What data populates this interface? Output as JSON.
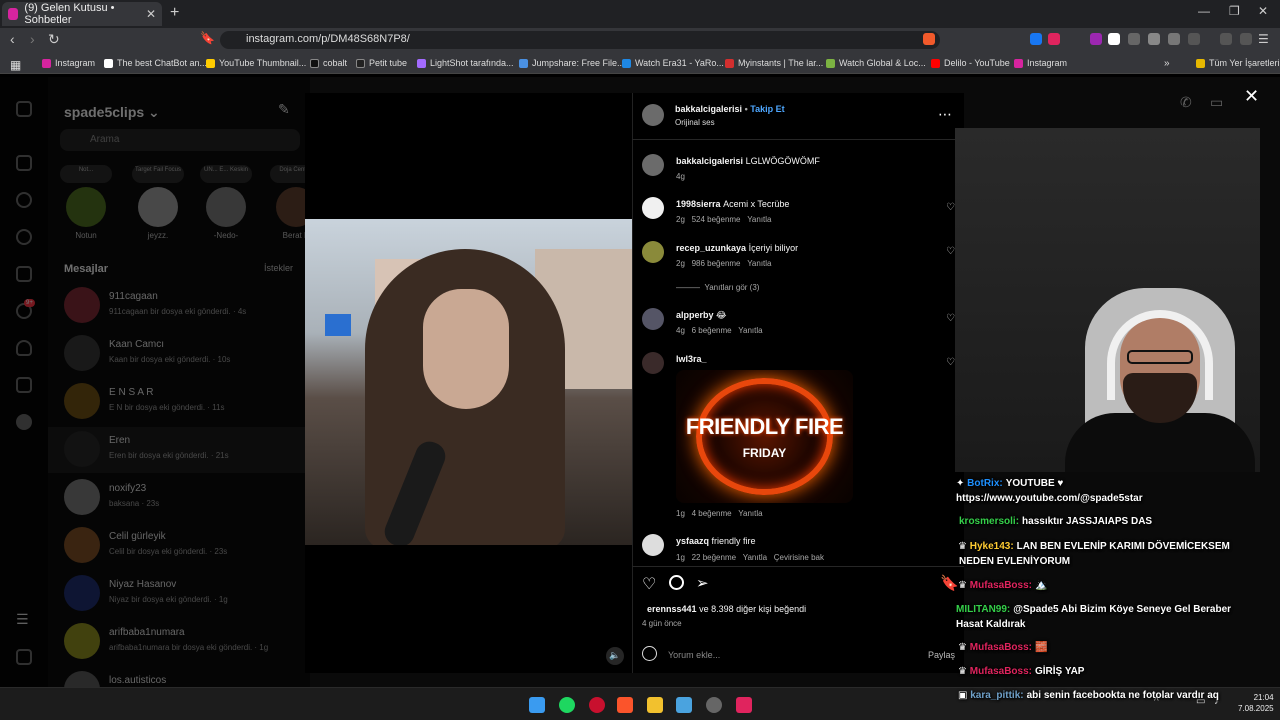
{
  "browser": {
    "tab_title": "(9) Gelen Kutusu • Sohbetler",
    "url": "instagram.com/p/DM48S68N7P8/",
    "bookmarks": [
      "Instagram",
      "The best ChatBot an...",
      "YouTube Thumbnail...",
      "cobalt",
      "Petit tube",
      "LightShot tarafında...",
      "Jumpshare: Free File...",
      "Watch Era31 - YaRo...",
      "Myinstants | The lar...",
      "Watch Global & Loc...",
      "Delilo - YouTube",
      "Instagram"
    ],
    "all_bookmarks": "Tüm Yer İşaretleri"
  },
  "dm": {
    "account": "spade5clips",
    "search_placeholder": "Arama",
    "notes": [
      "Not...",
      "Target Fail Focus",
      "UN... E... Keskin",
      "Doja Central"
    ],
    "stories": [
      "Notun",
      "jeyzz.",
      "-Nedo-",
      "Berat E"
    ],
    "messages_label": "Mesajlar",
    "requests_label": "İstekler",
    "badge": "9+",
    "threads": [
      {
        "name": "911cagaan",
        "sub": "911cagaan bir dosya eki gönderdi. · 4s"
      },
      {
        "name": "Kaan Camcı",
        "sub": "Kaan bir dosya eki gönderdi. · 10s"
      },
      {
        "name": "E N S A R",
        "sub": "E N bir dosya eki gönderdi. · 11s"
      },
      {
        "name": "Eren",
        "sub": "Eren bir dosya eki gönderdi. · 21s"
      },
      {
        "name": "noxify23",
        "sub": "baksana · 23s"
      },
      {
        "name": "Celil gürleyik",
        "sub": "Celil bir dosya eki gönderdi. · 23s"
      },
      {
        "name": "Niyaz Hasanov",
        "sub": "Niyaz bir dosya eki gönderdi. · 1g"
      },
      {
        "name": "arifbaba1numara",
        "sub": "arifbaba1numara bir dosya eki gönderdi. · 1g"
      },
      {
        "name": "los.autisticos",
        "sub": ""
      }
    ]
  },
  "post": {
    "author": "bakkalcigalerisi",
    "follow": "Takip Et",
    "audio": "Orijinal ses",
    "caption_user": "bakkalcigalerisi",
    "caption_text": "LGLWÖGÖWÖMF",
    "caption_time": "4g",
    "comments": [
      {
        "user": "1998sierra",
        "text": "Acemi x Tecrübe",
        "time": "2g",
        "likes": "524 beğenme",
        "reply": "Yanıtla"
      },
      {
        "user": "recep_uzunkaya",
        "text": "İçeriyi biliyor",
        "time": "2g",
        "likes": "986 beğenme",
        "reply": "Yanıtla",
        "see_replies": "Yanıtları gör (3)"
      },
      {
        "user": "alpperby",
        "text": "😂",
        "time": "4g",
        "likes": "6 beğenme",
        "reply": "Yanıtla"
      },
      {
        "user": "lwl3ra_",
        "text": "",
        "time": "1g",
        "likes": "4 beğenme",
        "reply": "Yanıtla",
        "gif_line1": "FRIENDLY FIRE",
        "gif_line2": "FRIDAY"
      },
      {
        "user": "ysfaazq",
        "text": "friendly fire",
        "time": "1g",
        "likes": "22 beğenme",
        "reply": "Yanıtla",
        "translate": "Çevirisine bak"
      }
    ],
    "liked_by_user": "erennss441",
    "liked_by_rest": "ve 8.398 diğer kişi beğendi",
    "posted_ago": "4 gün önce",
    "comment_placeholder": "Yorum ekle...",
    "share_label": "Paylaş"
  },
  "chat": [
    {
      "user": "BotRix:",
      "msg": "YOUTUBE ♥",
      "color": "#1e90ff"
    },
    {
      "user": "",
      "msg": "https://www.youtube.com/@spade5star",
      "color": "#ffffff"
    },
    {
      "user": "krosmersoli:",
      "msg": "hassıktır JASSJAIAPS DAS",
      "color": "#35d04a"
    },
    {
      "user": "Hyke143:",
      "msg": "LAN BEN EVLENİP KARIMI DÖVEMİCEKSEM",
      "color": "#ffcc33"
    },
    {
      "user": "",
      "msg": "NEDEN EVLENİYORUM",
      "color": "#ffffff"
    },
    {
      "user": "MufasaBoss:",
      "msg": "🏔️",
      "color": "#e0245e"
    },
    {
      "user": "MILITAN99:",
      "msg": "@Spade5 Abi Bizim Köye Seneye Gel Beraber",
      "color": "#35d04a"
    },
    {
      "user": "",
      "msg": "Hasat Kaldırak",
      "color": "#ffffff"
    },
    {
      "user": "MufasaBoss:",
      "msg": "🧱",
      "color": "#e0245e"
    },
    {
      "user": "MufasaBoss:",
      "msg": "GİRİŞ YAP",
      "color": "#e0245e"
    },
    {
      "user": "kara_pittik:",
      "msg": "abi senin facebookta ne fotolar vardır aq",
      "color": "#6fa0c8"
    }
  ],
  "clock": {
    "time": "21:04",
    "date": "7.08.2025"
  }
}
